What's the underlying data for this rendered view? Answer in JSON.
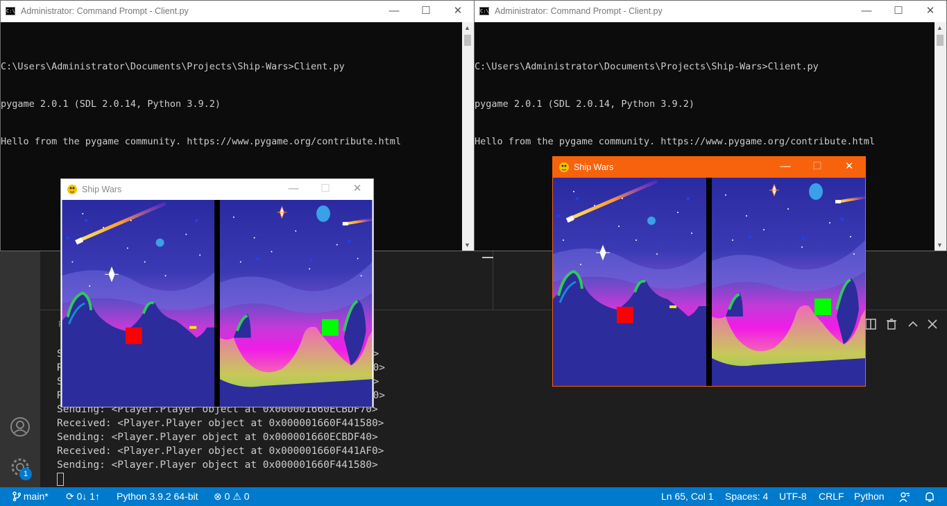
{
  "cmd_windows": [
    {
      "title": "Administrator: Command Prompt - Client.py",
      "lines": [
        "C:\\Users\\Administrator\\Documents\\Projects\\Ship-Wars>Client.py",
        "pygame 2.0.1 (SDL 2.0.14, Python 3.9.2)",
        "Hello from the pygame community. https://www.pygame.org/contribute.html"
      ]
    },
    {
      "title": "Administrator: Command Prompt - Client.py",
      "lines": [
        "C:\\Users\\Administrator\\Documents\\Projects\\Ship-Wars>Client.py",
        "pygame 2.0.1 (SDL 2.0.14, Python 3.9.2)",
        "Hello from the pygame community. https://www.pygame.org/contribute.html"
      ]
    }
  ],
  "window_controls": {
    "minimize": "—",
    "maximize": "☐",
    "close": "✕"
  },
  "game_windows": [
    {
      "title": "Ship Wars",
      "active": false
    },
    {
      "title": "Ship Wars",
      "active": true
    }
  ],
  "terminal": {
    "partial_lines": [
      "S",
      "R",
      "S",
      "R"
    ],
    "partial_suffixes": [
      "80>",
      "F70>",
      "F0>",
      "F40>"
    ],
    "lines": [
      "Sending: <Player.Player object at 0x000001660ECBDF70>",
      "Received: <Player.Player object at 0x000001660F441580>",
      "Sending: <Player.Player object at 0x000001660ECBDF40>",
      "Received: <Player.Player object at 0x000001660F441AF0>",
      "Sending: <Player.Player object at 0x000001660F441580>"
    ]
  },
  "activity": {
    "settings_badge": "1"
  },
  "statusbar": {
    "branch": "main*",
    "sync": "0↓ 1↑",
    "interpreter": "Python 3.9.2 64-bit",
    "errors": "0",
    "warnings": "0",
    "position": "Ln 65, Col 1",
    "spaces": "Spaces: 4",
    "encoding": "UTF-8",
    "eol": "CRLF",
    "language": "Python"
  },
  "colors": {
    "statusbar": "#007acc",
    "game_active_titlebar": "#f7630c",
    "player_red": "#ff0000",
    "player_green": "#00ff00",
    "bullet_yellow": "#ffea00"
  }
}
